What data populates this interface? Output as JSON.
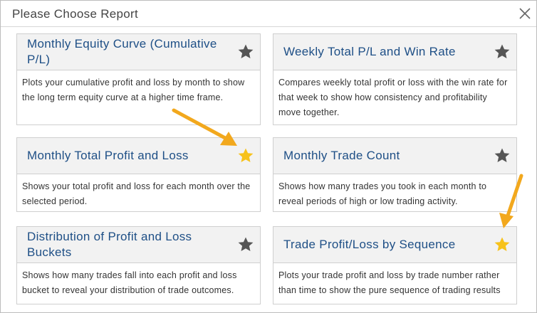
{
  "dialog": {
    "title": "Please Choose Report",
    "close_icon": "close-icon"
  },
  "colors": {
    "title_blue": "#1e4f86",
    "star_default": "#555555",
    "star_active": "#f7c21b",
    "arrow": "#f2a81d"
  },
  "reports": [
    {
      "title": "Monthly Equity Curve (Cumulative P/L)",
      "description": "Plots your cumulative profit and loss by month to show the long term equity curve at a higher time frame.",
      "favorite": false
    },
    {
      "title": "Weekly Total P/L and Win Rate",
      "description": "Compares weekly total profit or loss with the win rate for that week to show how consistency and profitability move together.",
      "favorite": false
    },
    {
      "title": "Monthly Total Profit and Loss",
      "description": "Shows your total profit and loss for each month over the selected period.",
      "favorite": true
    },
    {
      "title": "Monthly Trade Count",
      "description": "Shows how many trades you took in each month to reveal periods of high or low trading activity.",
      "favorite": false
    },
    {
      "title": "Distribution of Profit and Loss Buckets",
      "description": "Shows how many trades fall into each profit and loss bucket to reveal your distribution of trade outcomes.",
      "favorite": false
    },
    {
      "title": "Trade Profit/Loss by Sequence",
      "description": "Plots your trade profit and loss by trade number rather than time to show the pure sequence of trading results",
      "favorite": true
    }
  ]
}
